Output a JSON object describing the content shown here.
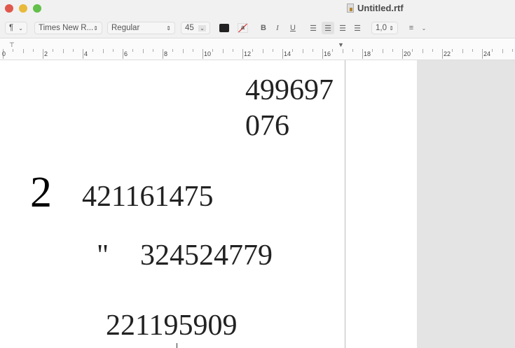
{
  "window": {
    "title": "Untitled.rtf"
  },
  "toolbar": {
    "paragraph_style": "¶",
    "font_family": "Times New R...",
    "font_style": "Regular",
    "font_size": "45",
    "bold": "B",
    "italic": "I",
    "underline": "U",
    "line_spacing": "1,0",
    "text_color": "#222222"
  },
  "ruler": {
    "labels": [
      "0",
      "2",
      "4",
      "6",
      "8",
      "10",
      "12",
      "14",
      "16",
      "18",
      "20",
      "22",
      "24"
    ]
  },
  "document": {
    "lines": [
      "499697",
      "076",
      "2",
      "421161475",
      "\"",
      "324524779",
      "221195909"
    ]
  }
}
